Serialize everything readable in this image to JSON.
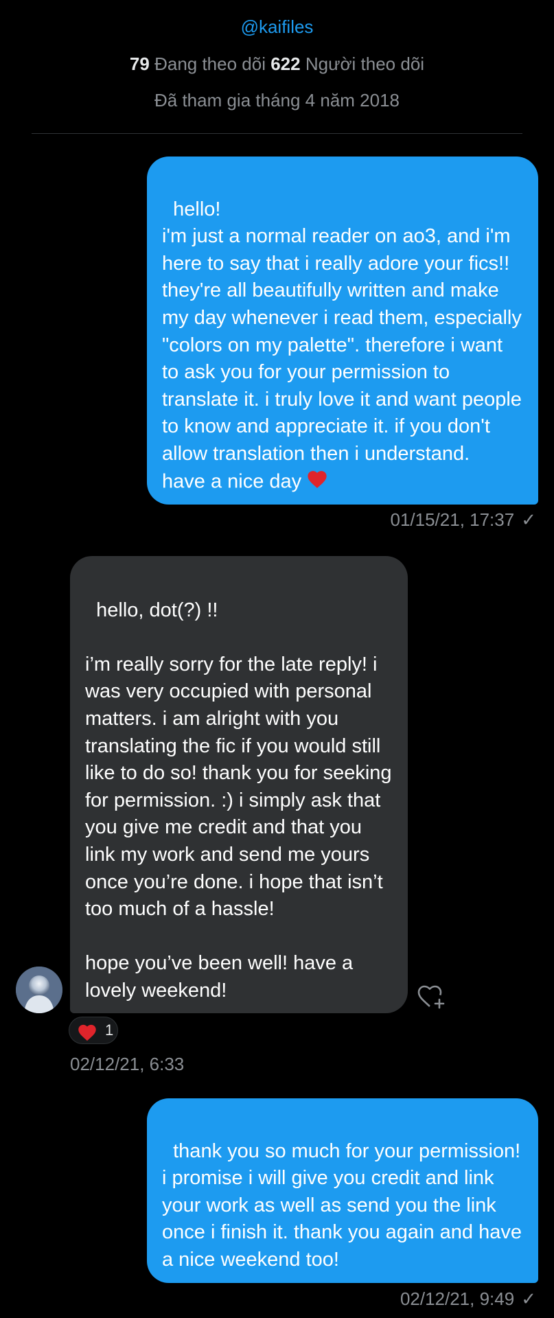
{
  "profile": {
    "handle": "@kaifiles",
    "following_count": "79",
    "following_label": "Đang theo dõi",
    "followers_count": "622",
    "followers_label": "Người theo dõi",
    "joined": "Đã tham gia tháng 4 năm 2018"
  },
  "messages": [
    {
      "direction": "sent",
      "text": "hello!\ni'm just a normal reader on ao3, and i'm here to say that i really adore your fics!! they're all beautifully written and make my day whenever i read them, especially \"colors on my palette\". therefore i want to ask you for your permission to translate it. i truly love it and want people to know and appreciate it. if you don't allow translation then i understand.\nhave a nice day",
      "emoji": "red-heart-emoji",
      "timestamp": "01/15/21, 17:37",
      "status": "✓"
    },
    {
      "direction": "received",
      "text": "hello, dot(?) !!\n\ni’m really sorry for the late reply! i was very occupied with personal matters. i am alright with you translating the fic if you would still like to do so! thank you for seeking for permission. :) i simply ask that you give me credit and that you link my work and send me yours once you’re done. i hope that isn’t too much of a hassle!\n\nhope you’ve been well! have a lovely weekend!",
      "reaction": {
        "icon": "red-heart-icon",
        "count": "1"
      },
      "timestamp": "02/12/21, 6:33"
    },
    {
      "direction": "sent",
      "text": "thank you so much for your permission! i promise i will give you credit and link your work as well as send you the link once i finish it. thank you again and have a nice weekend too!",
      "timestamp": "02/12/21, 9:49",
      "status": "✓"
    }
  ],
  "colors": {
    "background": "#000000",
    "sent_bubble": "#1d9bf0",
    "received_bubble": "#2f3133",
    "muted_text": "#8b8f94",
    "heart": "#f91880"
  }
}
